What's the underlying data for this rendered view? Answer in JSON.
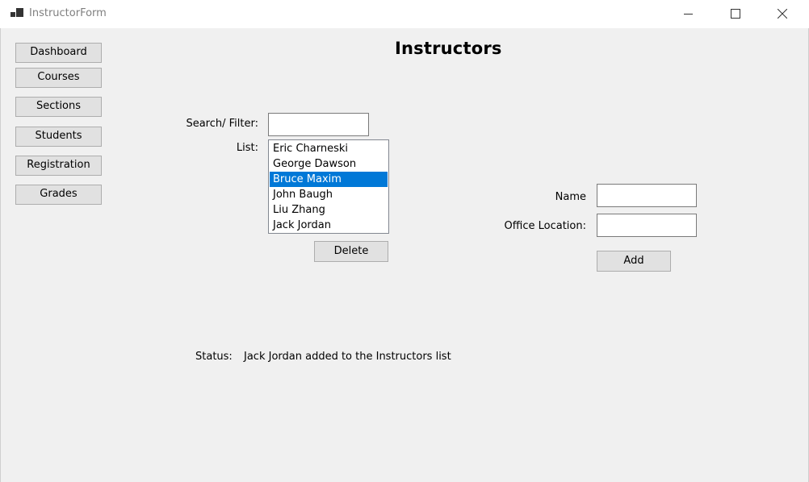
{
  "window": {
    "title": "InstructorForm",
    "controls": [
      "minimize-icon",
      "maximize-icon",
      "close-icon"
    ]
  },
  "nav": {
    "dashboard": "Dashboard",
    "courses": "Courses",
    "sections": "Sections",
    "students": "Students",
    "registration": "Registration",
    "grades": "Grades"
  },
  "main": {
    "title": "Instructors",
    "search_label": "Search/ Filter:",
    "search_value": "",
    "list_label": "List:",
    "list_items": [
      "Eric Charneski",
      "George Dawson",
      "Bruce Maxim",
      "John Baugh",
      "Liu Zhang",
      "Jack Jordan"
    ],
    "selected_item": "Bruce Maxim",
    "delete_label": "Delete"
  },
  "form": {
    "name_label": "Name",
    "name_value": "",
    "office_label": "Office Location:",
    "office_value": "",
    "add_label": "Add"
  },
  "status": {
    "label": "Status:",
    "message": "Jack Jordan added to the Instructors list"
  },
  "colors": {
    "selection": "#0078d7",
    "background": "#f0f0f0",
    "button": "#e1e1e1"
  }
}
